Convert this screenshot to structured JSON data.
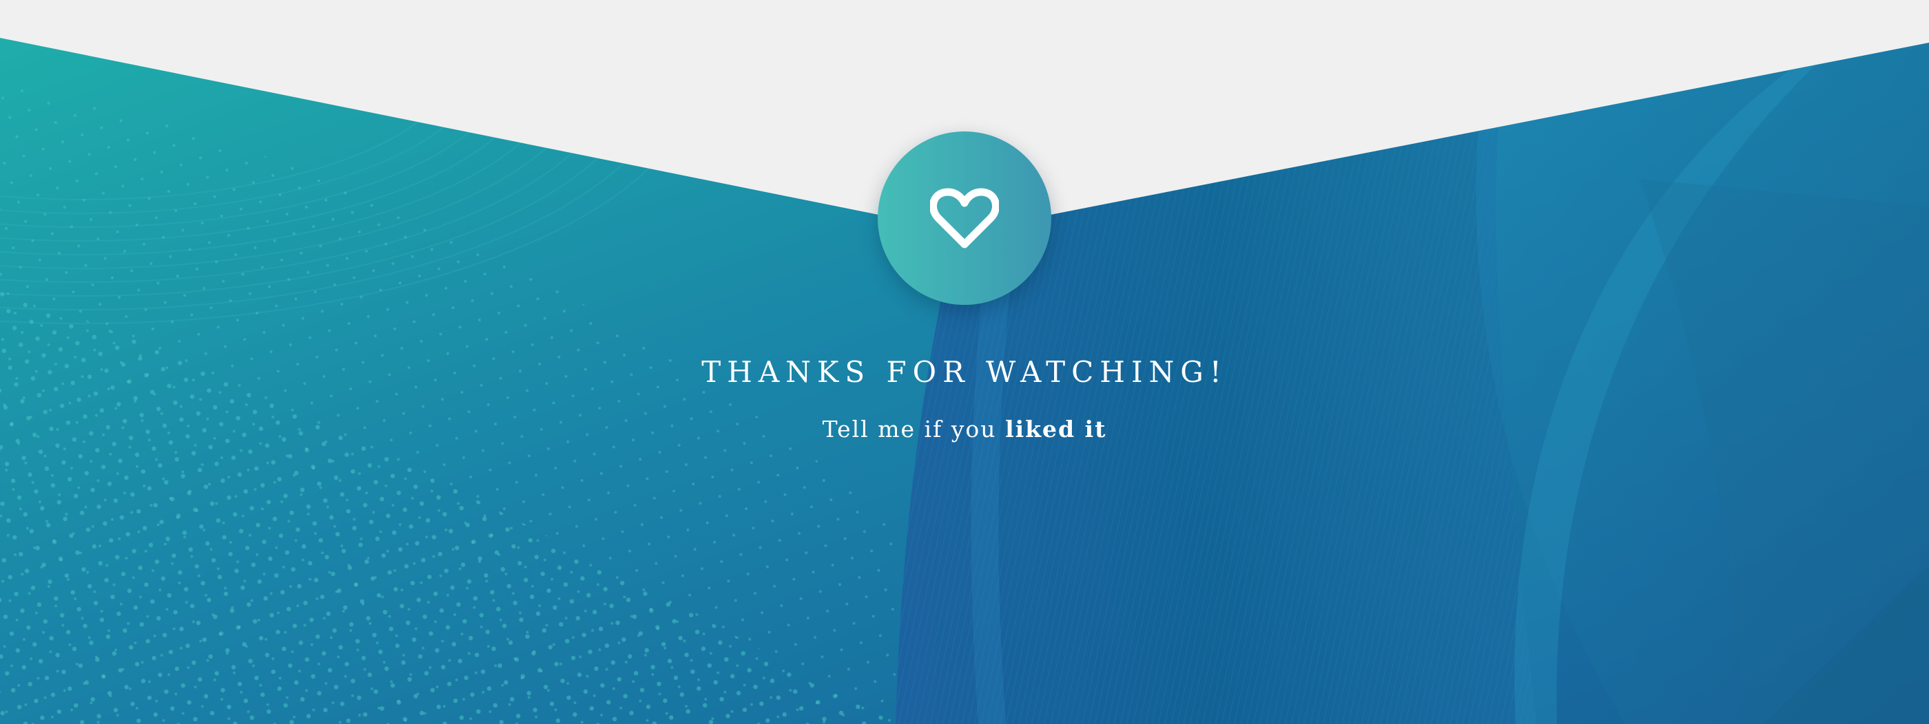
{
  "slide": {
    "title": "THANKS FOR WATCHING!",
    "subtitle_prefix": "Tell me if you",
    "subtitle_emphasis": "liked it",
    "icon": "heart-outline-icon"
  },
  "colors": {
    "page_background": "#f0f0f0",
    "teal_top_left": "#1fa9a6",
    "blue_middle": "#1c7fa6",
    "blue_deep": "#11629a",
    "badge_teal": "#45bdb7",
    "badge_blue": "#3d97b1",
    "text": "#ffffff"
  }
}
